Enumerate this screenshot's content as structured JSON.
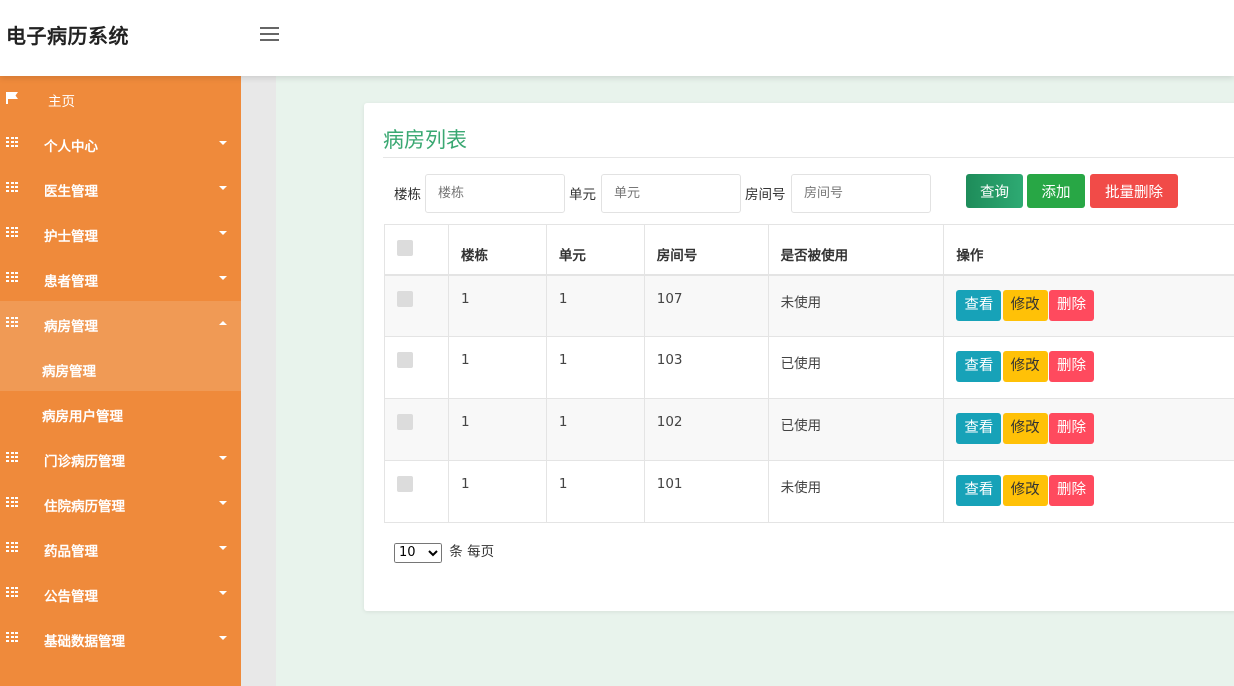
{
  "app": {
    "title": "电子病历系统"
  },
  "sidebar": {
    "home": "主页",
    "items": [
      {
        "label": "个人中心"
      },
      {
        "label": "医生管理"
      },
      {
        "label": "护士管理"
      },
      {
        "label": "患者管理"
      },
      {
        "label": "病房管理",
        "sub": [
          "病房管理",
          "病房用户管理"
        ]
      },
      {
        "label": "门诊病历管理"
      },
      {
        "label": "住院病历管理"
      },
      {
        "label": "药品管理"
      },
      {
        "label": "公告管理"
      },
      {
        "label": "基础数据管理"
      }
    ]
  },
  "page": {
    "title": "病房列表"
  },
  "filters": {
    "building_label": "楼栋",
    "building_placeholder": "楼栋",
    "unit_label": "单元",
    "unit_placeholder": "单元",
    "room_label": "房间号",
    "room_placeholder": "房间号"
  },
  "buttons": {
    "query": "查询",
    "add": "添加",
    "batch_delete": "批量删除"
  },
  "table": {
    "columns": [
      "楼栋",
      "单元",
      "房间号",
      "是否被使用",
      "操作"
    ],
    "rows": [
      {
        "building": "1",
        "unit": "1",
        "room": "107",
        "status": "未使用"
      },
      {
        "building": "1",
        "unit": "1",
        "room": "103",
        "status": "已使用"
      },
      {
        "building": "1",
        "unit": "1",
        "room": "102",
        "status": "已使用"
      },
      {
        "building": "1",
        "unit": "1",
        "room": "101",
        "status": "未使用"
      }
    ],
    "actions": {
      "view": "查看",
      "edit": "修改",
      "delete": "删除"
    }
  },
  "pagination": {
    "page_size": "10",
    "suffix": "条 每页"
  }
}
